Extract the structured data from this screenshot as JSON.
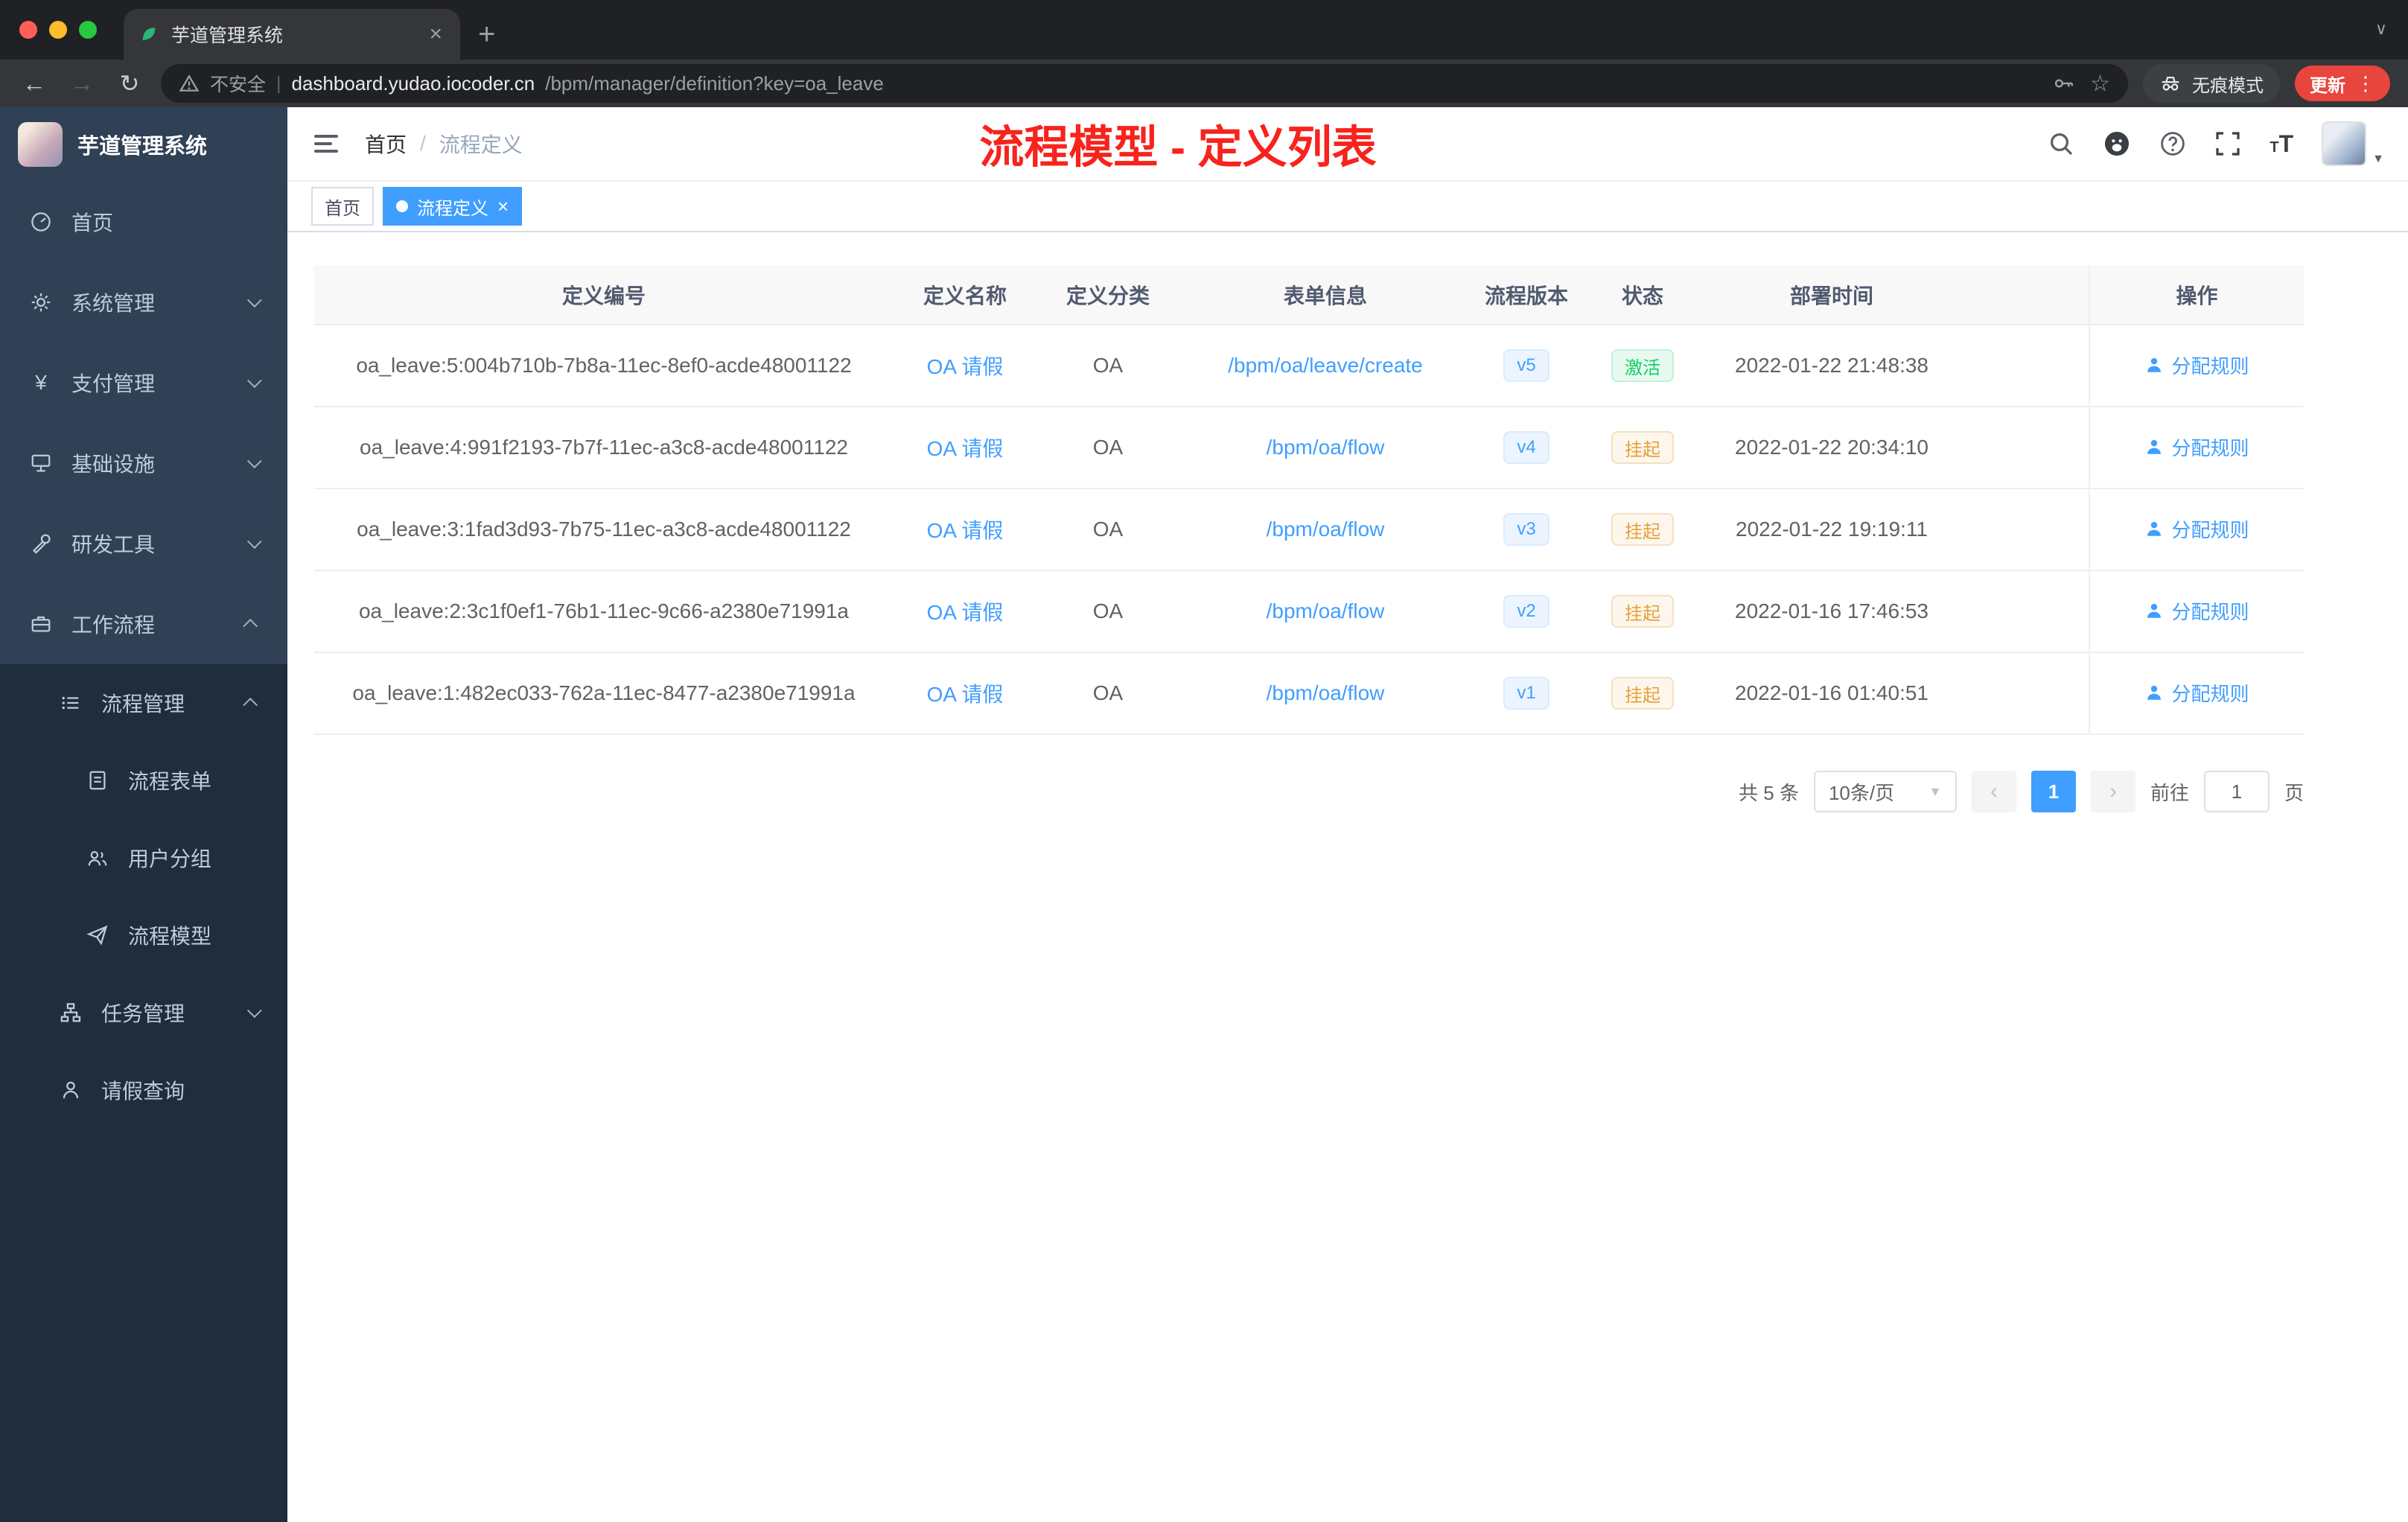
{
  "browser": {
    "tab_title": "芋道管理系统",
    "security_label": "不安全",
    "url_host": "dashboard.yudao.iocoder.cn",
    "url_path": "/bpm/manager/definition?key=oa_leave",
    "incognito_label": "无痕模式",
    "update_label": "更新"
  },
  "sidebar": {
    "title": "芋道管理系统",
    "home": "首页",
    "system_mgmt": "系统管理",
    "payment_mgmt": "支付管理",
    "infrastructure": "基础设施",
    "dev_tools": "研发工具",
    "workflow": "工作流程",
    "process_mgmt": "流程管理",
    "process_form": "流程表单",
    "user_group": "用户分组",
    "process_model": "流程模型",
    "task_mgmt": "任务管理",
    "leave_query": "请假查询"
  },
  "navbar": {
    "breadcrumb_home": "首页",
    "breadcrumb_current": "流程定义",
    "annotation": "流程模型 - 定义列表"
  },
  "tags": [
    {
      "label": "首页"
    },
    {
      "label": "流程定义"
    }
  ],
  "table": {
    "columns": [
      "定义编号",
      "定义名称",
      "定义分类",
      "表单信息",
      "流程版本",
      "状态",
      "部署时间",
      "操作"
    ],
    "action_label": "分配规则",
    "rows": [
      {
        "id": "oa_leave:5:004b710b-7b8a-11ec-8ef0-acde48001122",
        "name": "OA 请假",
        "category": "OA",
        "form": "/bpm/oa/leave/create",
        "version": "v5",
        "status": "激活",
        "deploy_time": "2022-01-22 21:48:38"
      },
      {
        "id": "oa_leave:4:991f2193-7b7f-11ec-a3c8-acde48001122",
        "name": "OA 请假",
        "category": "OA",
        "form": "/bpm/oa/flow",
        "version": "v4",
        "status": "挂起",
        "deploy_time": "2022-01-22 20:34:10"
      },
      {
        "id": "oa_leave:3:1fad3d93-7b75-11ec-a3c8-acde48001122",
        "name": "OA 请假",
        "category": "OA",
        "form": "/bpm/oa/flow",
        "version": "v3",
        "status": "挂起",
        "deploy_time": "2022-01-22 19:19:11"
      },
      {
        "id": "oa_leave:2:3c1f0ef1-76b1-11ec-9c66-a2380e71991a",
        "name": "OA 请假",
        "category": "OA",
        "form": "/bpm/oa/flow",
        "version": "v2",
        "status": "挂起",
        "deploy_time": "2022-01-16 17:46:53"
      },
      {
        "id": "oa_leave:1:482ec033-762a-11ec-8477-a2380e71991a",
        "name": "OA 请假",
        "category": "OA",
        "form": "/bpm/oa/flow",
        "version": "v1",
        "status": "挂起",
        "deploy_time": "2022-01-16 01:40:51"
      }
    ]
  },
  "pagination": {
    "total": "共 5 条",
    "page_size": "10条/页",
    "current_page": "1",
    "goto_label": "前往",
    "goto_value": "1",
    "page_unit": "页"
  },
  "colors": {
    "accent": "#409eff",
    "success": "#13ce66",
    "warning": "#e6a23c",
    "annotation_red": "#f7231c",
    "sidebar_bg": "#304156",
    "submenu_bg": "#1f2d3d"
  }
}
